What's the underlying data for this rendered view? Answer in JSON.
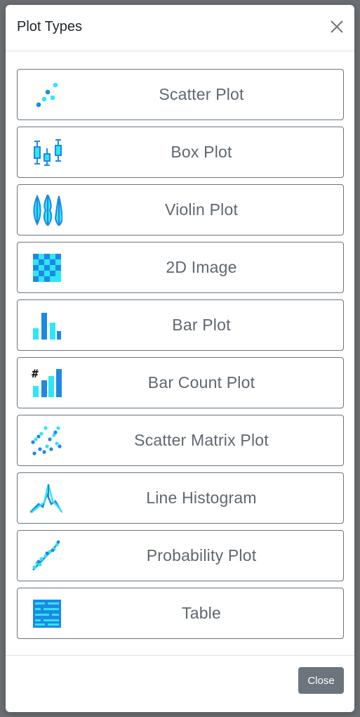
{
  "modal": {
    "title": "Plot Types",
    "close_button_label": "Close"
  },
  "plot_types": [
    {
      "label": "Scatter Plot",
      "icon": "scatter-plot-icon"
    },
    {
      "label": "Box Plot",
      "icon": "box-plot-icon"
    },
    {
      "label": "Violin Plot",
      "icon": "violin-plot-icon"
    },
    {
      "label": "2D Image",
      "icon": "2d-image-icon"
    },
    {
      "label": "Bar Plot",
      "icon": "bar-plot-icon"
    },
    {
      "label": "Bar Count Plot",
      "icon": "bar-count-plot-icon"
    },
    {
      "label": "Scatter Matrix Plot",
      "icon": "scatter-matrix-plot-icon"
    },
    {
      "label": "Line Histogram",
      "icon": "line-histogram-icon"
    },
    {
      "label": "Probability Plot",
      "icon": "probability-plot-icon"
    },
    {
      "label": "Table",
      "icon": "table-icon"
    }
  ],
  "colors": {
    "accent_blue": "#1e88e5",
    "accent_cyan": "#2ee6f6",
    "button_border": "#6c757d",
    "label_text": "#5f6770"
  },
  "icons": {
    "bar_count_glyph": "#"
  }
}
